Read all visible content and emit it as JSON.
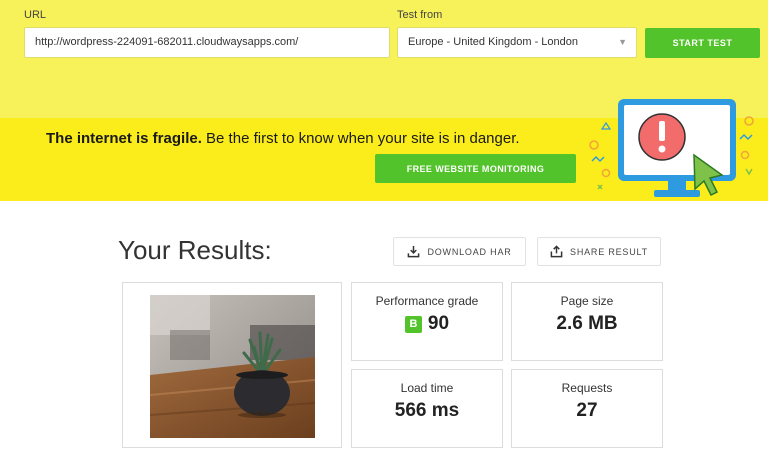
{
  "form": {
    "url_label": "URL",
    "url_value": "http://wordpress-224091-682011.cloudwaysapps.com/",
    "location_label": "Test from",
    "location_value": "Europe - United Kingdom - London",
    "start_label": "START TEST"
  },
  "banner": {
    "bold_text": "The internet is fragile.",
    "rest_text": " Be the first to know when your site is in danger.",
    "button_label": "FREE WEBSITE MONITORING"
  },
  "results": {
    "title": "Your Results:",
    "download_label": "DOWNLOAD HAR",
    "share_label": "SHARE RESULT",
    "metrics": [
      {
        "label": "Performance grade",
        "grade": "B",
        "value": "90"
      },
      {
        "label": "Page size",
        "value": "2.6 MB"
      },
      {
        "label": "Load time",
        "value": "566 ms"
      },
      {
        "label": "Requests",
        "value": "27"
      }
    ]
  },
  "colors": {
    "top_band": "#f7f15a",
    "banner": "#fbec1b",
    "accent_green": "#52c32a",
    "monitor_blue": "#2e9be0",
    "alert_red": "#f26c6c"
  },
  "icons": [
    "chevron-down-icon",
    "download-icon",
    "share-icon",
    "monitor-alert-icon",
    "cursor-icon"
  ]
}
